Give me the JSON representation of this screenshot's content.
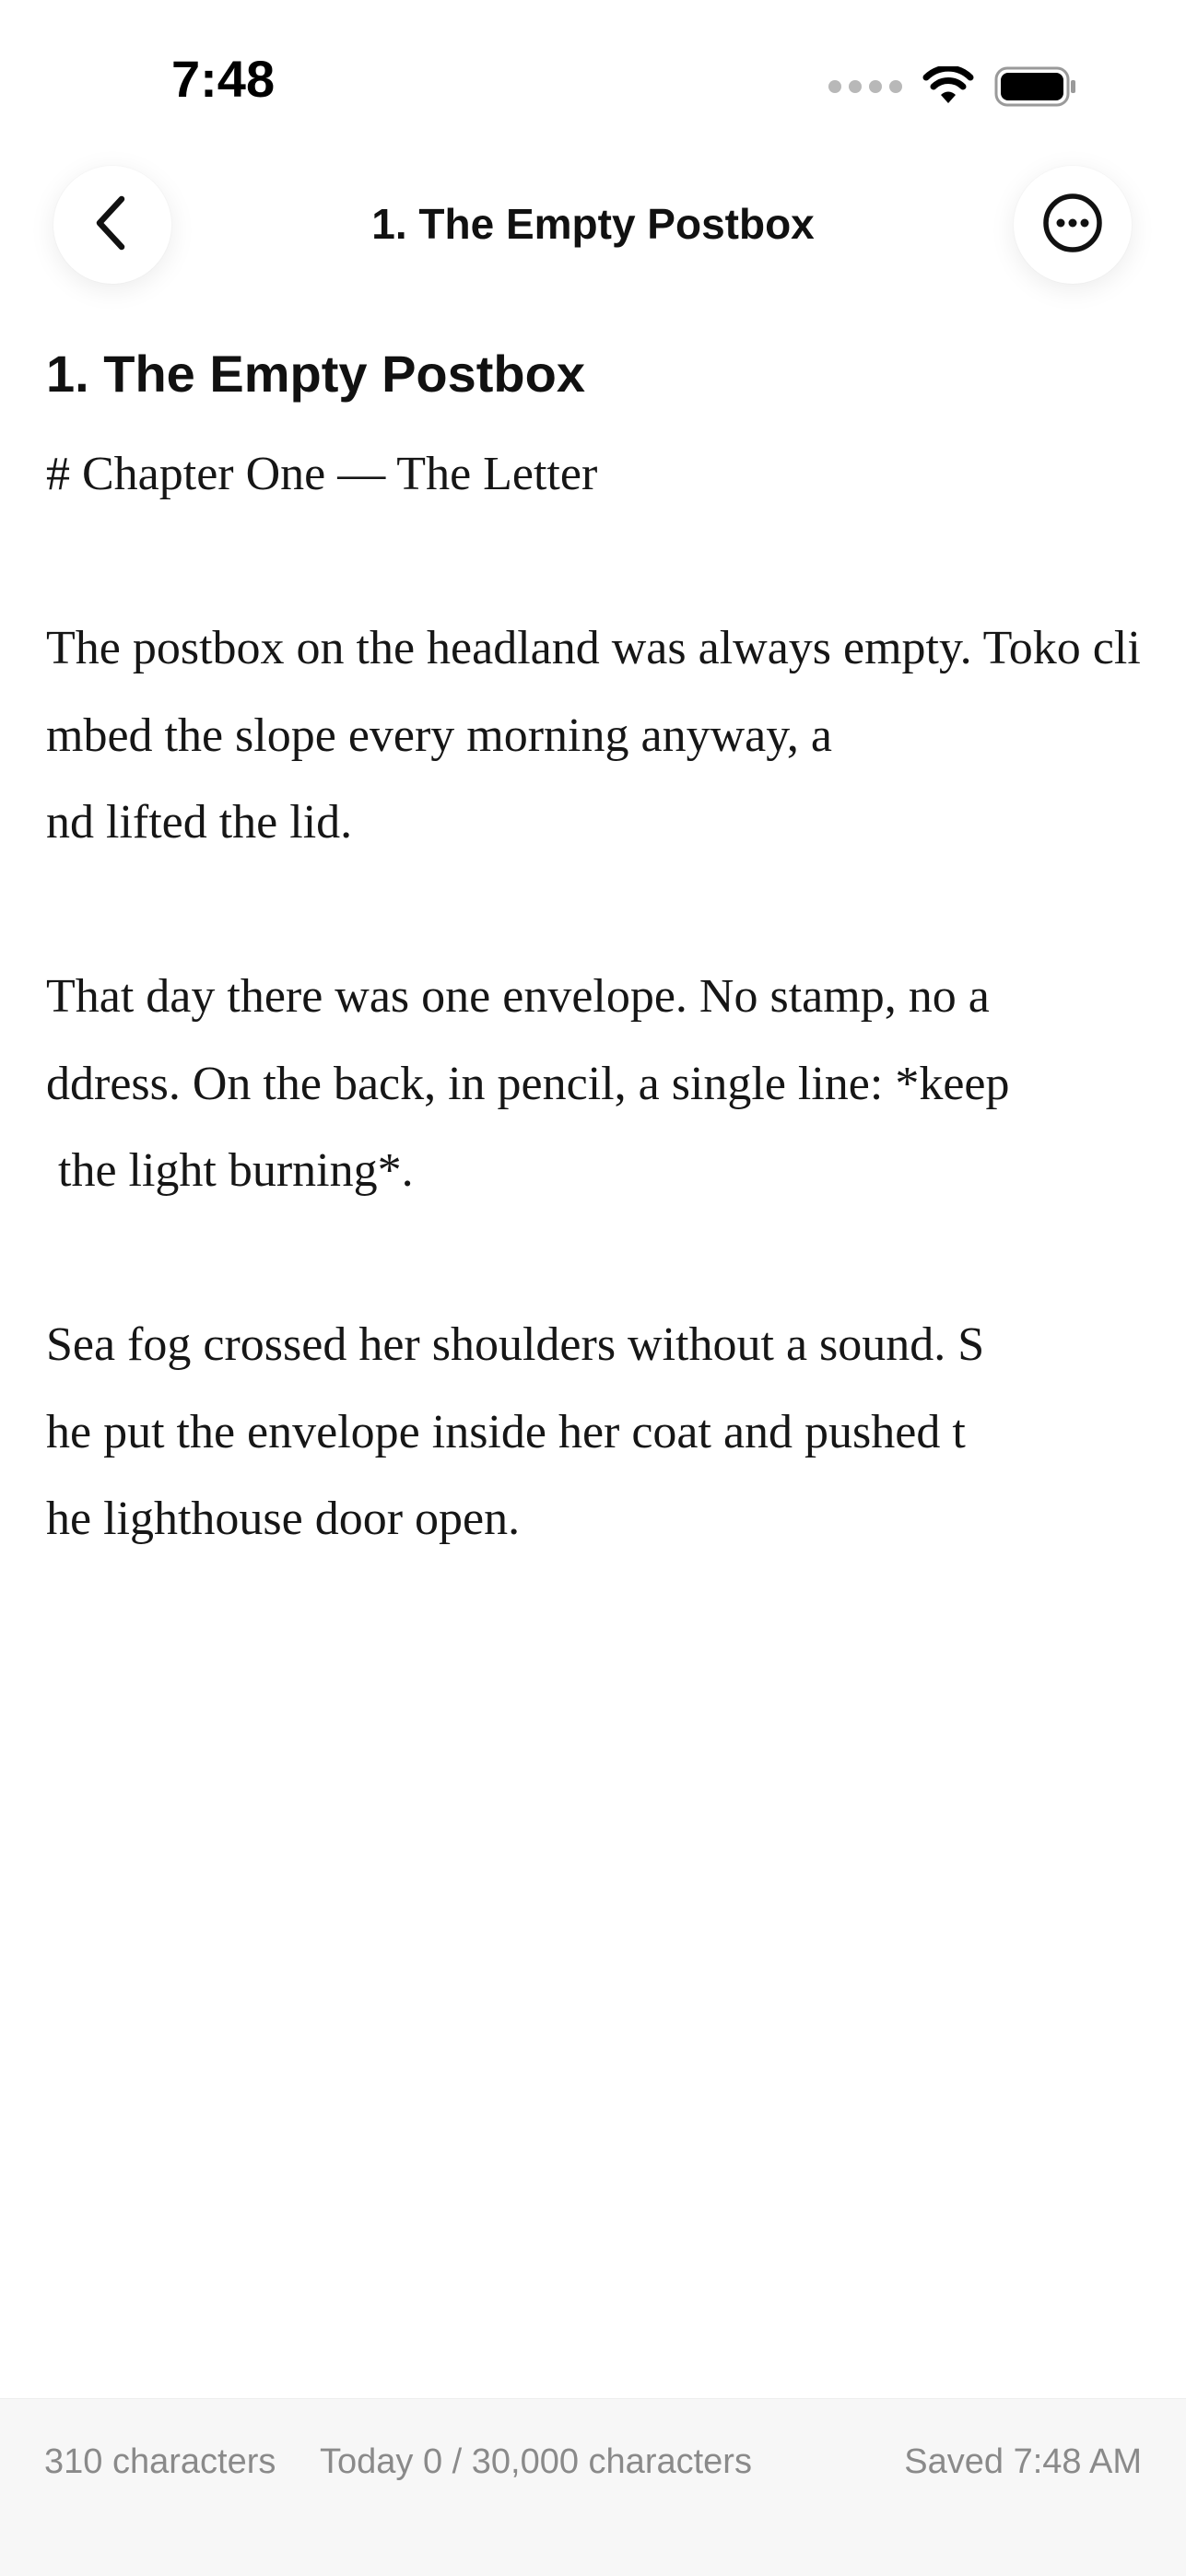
{
  "status_bar": {
    "time": "7:48"
  },
  "nav": {
    "title": "1. The Empty Postbox",
    "back_icon": "chevron-left-icon",
    "more_icon": "ellipsis-circle-icon"
  },
  "document": {
    "title": "1. The Empty Postbox",
    "body": "# Chapter One — The Letter\n\nThe postbox on the headland was always empty. Toko climbed the slope every morning anyway, a\nnd lifted the lid.\n\nThat day there was one envelope. No stamp, no a\nddress. On the back, in pencil, a single line: *keep\n the light burning*.\n\nSea fog crossed her shoulders without a sound. S\nhe put the envelope inside her coat and pushed t\nhe lighthouse door open."
  },
  "footer": {
    "char_count": "310 characters",
    "daily_goal": "Today 0 / 30,000 characters",
    "saved_status": "Saved 7:48 AM"
  }
}
